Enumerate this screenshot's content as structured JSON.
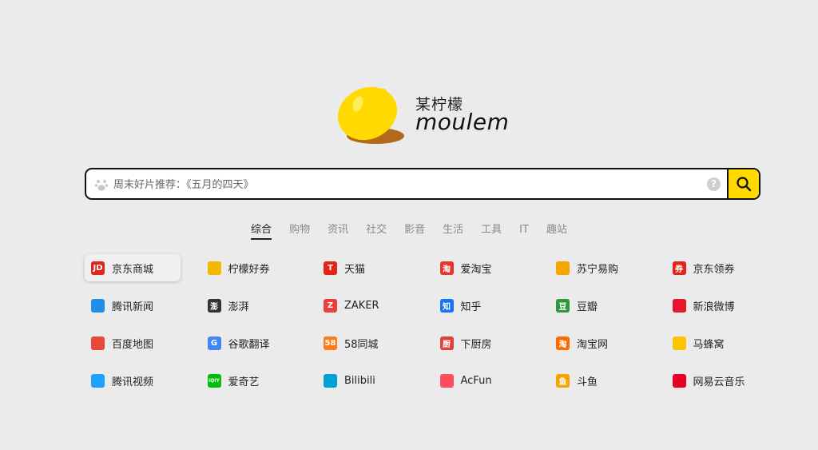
{
  "logo": {
    "brand_cn": "某柠檬",
    "brand_en": "moulem"
  },
  "search": {
    "placeholder": "周末好片推荐：《五月的四天》",
    "help_label": "?"
  },
  "categories": [
    {
      "label": "综合",
      "active": true
    },
    {
      "label": "购物"
    },
    {
      "label": "资讯"
    },
    {
      "label": "社交"
    },
    {
      "label": "影音"
    },
    {
      "label": "生活"
    },
    {
      "label": "工具"
    },
    {
      "label": "IT"
    },
    {
      "label": "趣站"
    }
  ],
  "sites": [
    [
      {
        "label": "京东商城",
        "icon": "jd-icon",
        "icon_text": "JD",
        "color": "#e1251b"
      },
      {
        "label": "柠檬好券",
        "icon": "lemon-coupon-icon",
        "icon_text": "",
        "color": "#f5b800"
      },
      {
        "label": "天猫",
        "icon": "tmall-icon",
        "icon_text": "T",
        "color": "#e1251b"
      },
      {
        "label": "爱淘宝",
        "icon": "aitaobao-icon",
        "icon_text": "淘",
        "color": "#e8352b"
      },
      {
        "label": "苏宁易购",
        "icon": "suning-icon",
        "icon_text": "",
        "color": "#f5a400"
      },
      {
        "label": "京东领券",
        "icon": "jd-coupon-icon",
        "icon_text": "券",
        "color": "#e1251b"
      }
    ],
    [
      {
        "label": "腾讯新闻",
        "icon": "tencent-news-icon",
        "icon_text": "",
        "color": "#1f8ee8"
      },
      {
        "label": "澎湃",
        "icon": "pengpai-icon",
        "icon_text": "澎",
        "color": "#333333"
      },
      {
        "label": "ZAKER",
        "icon": "zaker-icon",
        "icon_text": "Z",
        "color": "#e84040"
      },
      {
        "label": "知乎",
        "icon": "zhihu-icon",
        "icon_text": "知",
        "color": "#1772f6"
      },
      {
        "label": "豆瓣",
        "icon": "douban-icon",
        "icon_text": "豆",
        "color": "#2e963d"
      },
      {
        "label": "新浪微博",
        "icon": "weibo-icon",
        "icon_text": "",
        "color": "#e6162d"
      }
    ],
    [
      {
        "label": "百度地图",
        "icon": "baidu-map-icon",
        "icon_text": "",
        "color": "#e8483a"
      },
      {
        "label": "谷歌翻译",
        "icon": "google-translate-icon",
        "icon_text": "G",
        "color": "#4285f4"
      },
      {
        "label": "58同城",
        "icon": "58-icon",
        "icon_text": "58",
        "color": "#ff7a1c"
      },
      {
        "label": "下厨房",
        "icon": "xiachufang-icon",
        "icon_text": "厨",
        "color": "#e3403a"
      },
      {
        "label": "淘宝网",
        "icon": "taobao-icon",
        "icon_text": "淘",
        "color": "#ff6a00"
      },
      {
        "label": "马蜂窝",
        "icon": "mafengwo-icon",
        "icon_text": "",
        "color": "#ffc400"
      }
    ],
    [
      {
        "label": "腾讯视频",
        "icon": "tencent-video-icon",
        "icon_text": "",
        "color": "#20a0ff"
      },
      {
        "label": "爱奇艺",
        "icon": "iqiyi-icon",
        "icon_text": "iQIY",
        "color": "#00be06"
      },
      {
        "label": "Bilibili",
        "icon": "bilibili-icon",
        "icon_text": "",
        "color": "#00a1d6"
      },
      {
        "label": "AcFun",
        "icon": "acfun-icon",
        "icon_text": "",
        "color": "#fd4c5d"
      },
      {
        "label": "斗鱼",
        "icon": "douyu-icon",
        "icon_text": "鱼",
        "color": "#f5a400"
      },
      {
        "label": "网易云音乐",
        "icon": "netease-music-icon",
        "icon_text": "",
        "color": "#e60026"
      }
    ]
  ]
}
